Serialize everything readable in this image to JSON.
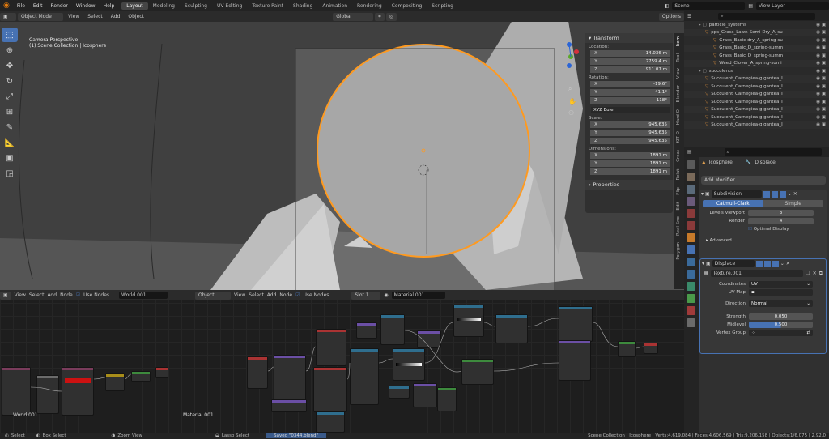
{
  "menus": [
    "File",
    "Edit",
    "Render",
    "Window",
    "Help"
  ],
  "workspaces": [
    "Layout",
    "Modeling",
    "Sculpting",
    "UV Editing",
    "Texture Paint",
    "Shading",
    "Animation",
    "Rendering",
    "Compositing",
    "Scripting"
  ],
  "scene": "Scene",
  "view_layer": "View Layer",
  "viewport": {
    "mode": "Object Mode",
    "menus": [
      "View",
      "Select",
      "Add",
      "Object"
    ],
    "orientation": "Global",
    "options": "Options",
    "overlay_line1": "Camera Perspective",
    "overlay_line2": "(1) Scene Collection | Icosphere"
  },
  "transform": {
    "title": "Transform",
    "location_label": "Location:",
    "location": [
      {
        "a": "X",
        "v": "-14.036 m"
      },
      {
        "a": "Y",
        "v": "2759.4 m"
      },
      {
        "a": "Z",
        "v": "911.07 m"
      }
    ],
    "rotation_label": "Rotation:",
    "rotation": [
      {
        "a": "X",
        "v": "-19.6°"
      },
      {
        "a": "Y",
        "v": "41.1°"
      },
      {
        "a": "Z",
        "v": "-118°"
      }
    ],
    "rotation_mode": "XYZ Euler",
    "scale_label": "Scale:",
    "scale": [
      {
        "a": "X",
        "v": "945.635"
      },
      {
        "a": "Y",
        "v": "945.635"
      },
      {
        "a": "Z",
        "v": "945.635"
      }
    ],
    "dimensions_label": "Dimensions:",
    "dimensions": [
      {
        "a": "X",
        "v": "1891 m"
      },
      {
        "a": "Y",
        "v": "1891 m"
      },
      {
        "a": "Z",
        "v": "1891 m"
      }
    ],
    "properties": "Properties"
  },
  "sidebar_tabs": [
    "Item",
    "Tool",
    "View",
    "Blender",
    "Hard O",
    "KIT O",
    "Creat",
    "Relati",
    "Flip",
    "Edit",
    "Real Sno",
    "Polygon"
  ],
  "node_editor": {
    "menus": [
      "View",
      "Select",
      "Add",
      "Node"
    ],
    "use_nodes": "Use Nodes",
    "world": "World.001",
    "object": "Object",
    "menus2": [
      "View",
      "Select",
      "Add",
      "Node"
    ],
    "use_nodes2": "Use Nodes",
    "slot": "Slot 1",
    "material": "Material.001",
    "label_world": "World.001",
    "label_material": "Material.001"
  },
  "outliner": [
    "particle_systems",
    "pps_Grass_Lawn-Semi-Dry_A_su",
    "Grass_Basic-dry_A_spring-su",
    "Grass_Basic_D_spring-summ",
    "Grass_Basic_D_spring-summ",
    "Weed_Clover_A_spring-sumi",
    "succulents",
    "Succulent_Carnegiea-gigantea_I",
    "Succulent_Carnegiea-gigantea_I",
    "Succulent_Carnegiea-gigantea_I",
    "Succulent_Carnegiea-gigantea_I",
    "Succulent_Carnegiea-gigantea_I",
    "Succulent_Carnegiea-gigantea_I",
    "Succulent_Carnegiea-gigantea_I"
  ],
  "properties": {
    "object": "Icosphere",
    "modifier_context": "Displace",
    "add_modifier": "Add Modifier",
    "subdivision": {
      "name": "Subdivision",
      "catmull": "Catmull-Clark",
      "simple": "Simple",
      "levels_label": "Levels Viewport",
      "levels": "3",
      "render_label": "Render",
      "render": "4",
      "optimal": "Optimal Display",
      "advanced": "Advanced"
    },
    "displace": {
      "name": "Displace",
      "texture": "Texture.001",
      "coords_label": "Coordinates",
      "coords": "UV",
      "uvmap_label": "UV Map",
      "direction_label": "Direction",
      "direction": "Normal",
      "strength_label": "Strength",
      "strength": "0.050",
      "midlevel_label": "Midlevel",
      "midlevel": "0.500",
      "vgroup_label": "Vertex Group"
    }
  },
  "status": {
    "select": "Select",
    "box_select": "Box Select",
    "zoom": "Zoom View",
    "lasso": "Lasso Select",
    "saved": "Saved \"0344.blend\"",
    "stats": "Scene Collection | Icosphere | Verts:4,619,084 | Faces:4,606,569 | Tris:9,206,158 | Objects:1/6,075 | 2.92.0"
  },
  "colors": {
    "accent": "#4772b3",
    "selection": "#ff9a1f",
    "header": "#232323"
  }
}
